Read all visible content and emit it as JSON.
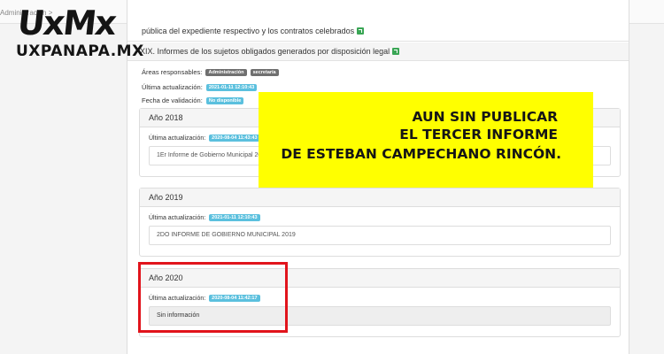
{
  "breadcrumb": "Administración > ",
  "logo": {
    "mark": "UxMx",
    "site": "UXPANAPA.MX"
  },
  "prev_row_text": "pública del expediente respectivo y los contratos celebrados",
  "section": {
    "title": "XIX. Informes de los sujetos obligados generados por disposición legal",
    "areas_label": "Áreas responsables:",
    "areas": [
      "Administración",
      "secretaría"
    ],
    "updated_label": "Última actualización:",
    "updated_value": "2021-01-11 12:10:43",
    "validation_label": "Fecha de validación:",
    "validation_value": "No disponible"
  },
  "years": [
    {
      "title": "Año 2018",
      "updated_label": "Última actualización:",
      "updated_value": "2020-08-04 11:43:43",
      "document": "1Er Informe de Gobierno Municipal 20"
    },
    {
      "title": "Año 2019",
      "updated_label": "Última actualización:",
      "updated_value": "2021-01-11 12:10:43",
      "document": "2DO INFORME DE GOBIERNO MUNICIPAL 2019"
    },
    {
      "title": "Año 2020",
      "updated_label": "Última actualización:",
      "updated_value": "2020-08-04 11:42:17",
      "document": "Sin información"
    }
  ],
  "banner": {
    "lines": [
      "AUN SIN PUBLICAR",
      "EL TERCER INFORME",
      "DE ESTEBAN CAMPECHANO RINCÓN."
    ]
  },
  "colors": {
    "banner_yellow": "#ffff00",
    "highlight_red": "#e1141c",
    "badge_blue": "#5bc0de",
    "badge_gray": "#6f6f6f",
    "link_icon_green": "#3aa655"
  }
}
